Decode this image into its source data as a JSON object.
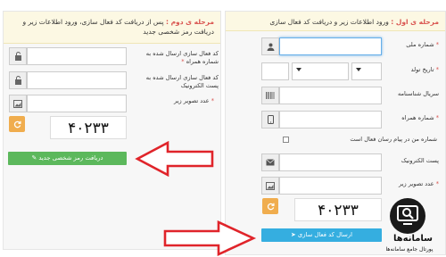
{
  "step1": {
    "step_label": "مرحله ی اول :",
    "instruction": "ورود اطلاعات زیر و دریافت کد فعال سازی",
    "fields": {
      "national_code_label": "شماره ملی",
      "birth_date_label": "تاریخ تولد",
      "id_serial_label": "سریال شناسنامه",
      "phone_label": "شماره همراه",
      "sms_consent_label": "شماره من در پیام رسان فعال است",
      "email_label": "پست الکترونیک",
      "captcha_label": "عدد تصویر زیر"
    },
    "required_mark": "*",
    "captcha_code": "۴۰۲۳۳",
    "submit_label": "ارسال کد فعال سازی"
  },
  "step2": {
    "step_label": "مرحله ی دوم :",
    "instruction": "پس از دریافت کد فعال سازی، ورود اطلاعات زیر و دریافت رمز شخصی جدید",
    "fields": {
      "sms_code_label": "کد فعال سازی ارسال شده به شماره همراه",
      "email_code_label": "کد فعال سازی ارسال شده به پست الکترونیک",
      "captcha_label": "عدد تصویر زیر"
    },
    "required_mark": "*",
    "captcha_code": "۴۰۲۳۳",
    "submit_label": "دریافت رمز شخصی جدید"
  },
  "watermark": {
    "brand": "سامانه‌ها",
    "tagline": "پورتال جامع سامانه‌ها"
  },
  "colors": {
    "required": "#d9534f",
    "header_bg": "#fcf8e3",
    "green_button": "#5cb85c",
    "blue_button": "#35aee0",
    "refresh_button": "#f0ad4e",
    "arrow": "#e0242a"
  }
}
